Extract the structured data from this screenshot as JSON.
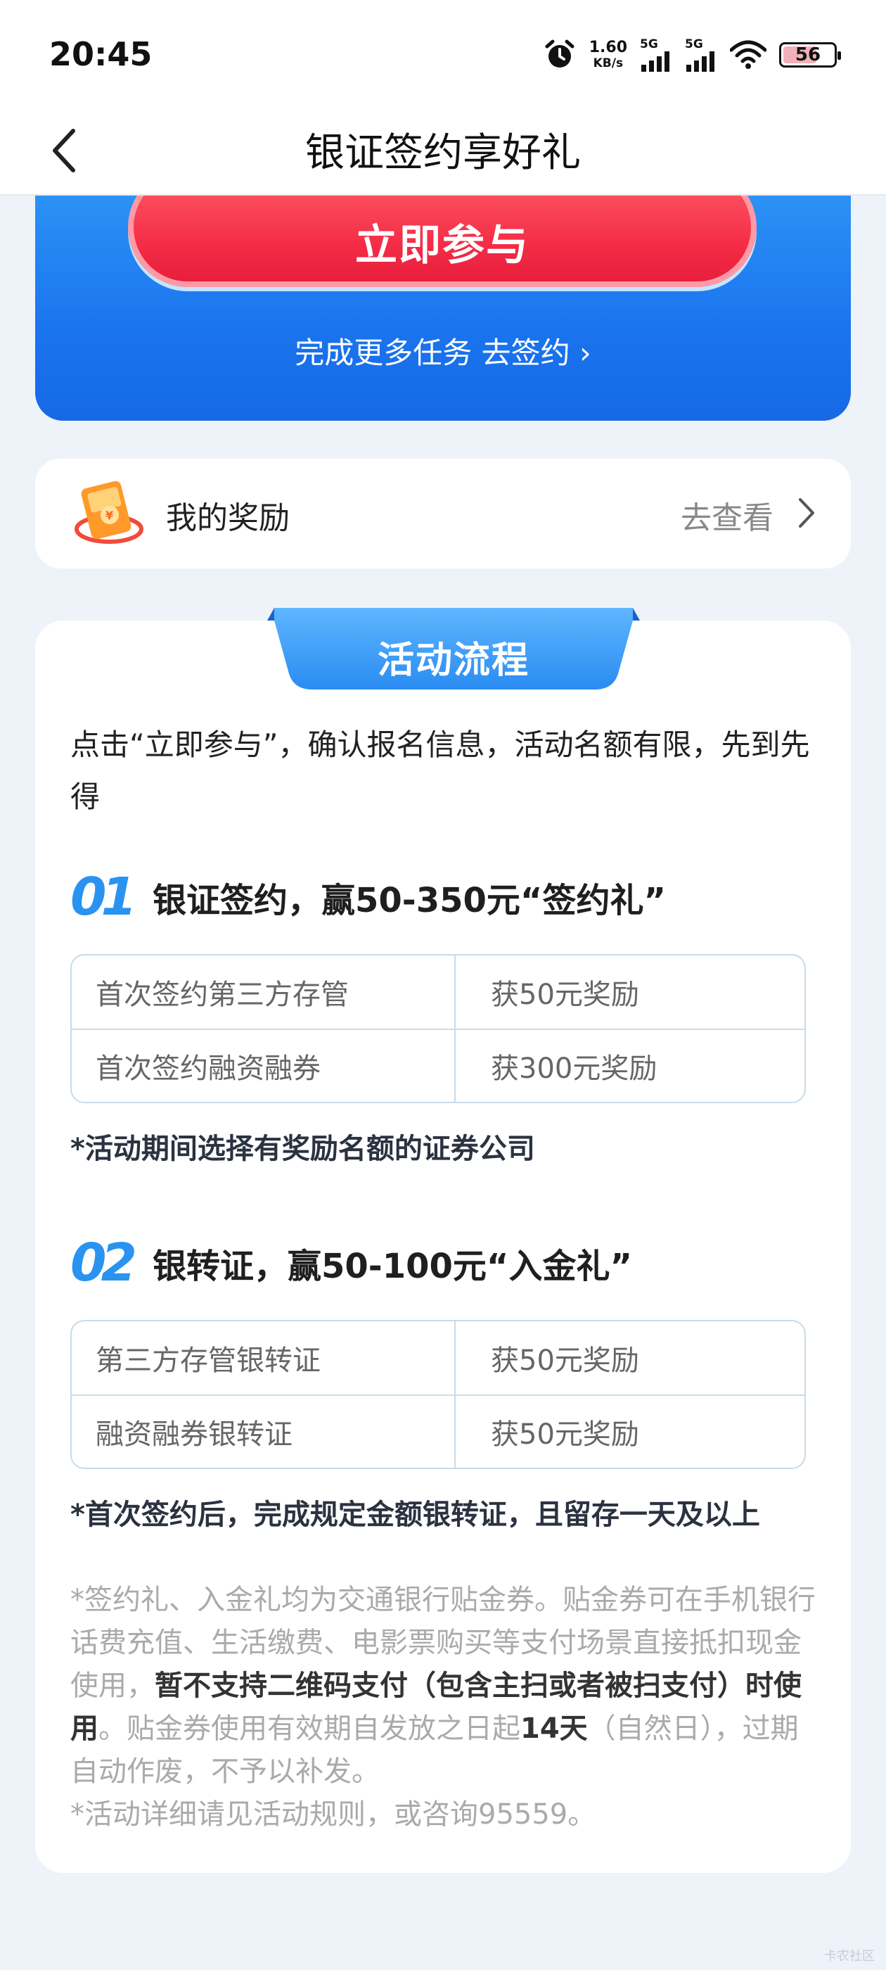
{
  "status_bar": {
    "time": "20:45",
    "net_speed_value": "1.60",
    "net_speed_unit": "KB/s",
    "sim1": "5G",
    "sim2": "5G",
    "battery": "56"
  },
  "nav": {
    "title": "银证签约享好礼"
  },
  "banner": {
    "join_button": "立即参与",
    "more_tasks_link": "完成更多任务 去签约 ›"
  },
  "rewards": {
    "label": "我的奖励",
    "view": "去查看"
  },
  "process": {
    "tab_title": "活动流程",
    "intro": "点击“立即参与”，确认报名信息，活动名额有限，先到先得",
    "step1": {
      "num": "01",
      "title": "银证签约，赢50-350元“签约礼”",
      "rows": [
        {
          "item": "首次签约第三方存管",
          "reward": "获50元奖励"
        },
        {
          "item": "首次签约融资融券",
          "reward": "获300元奖励"
        }
      ],
      "note": "*活动期间选择有奖励名额的证券公司"
    },
    "step2": {
      "num": "02",
      "title": "银转证，赢50-100元“入金礼”",
      "rows": [
        {
          "item": "第三方存管银转证",
          "reward": "获50元奖励"
        },
        {
          "item": "融资融券银转证",
          "reward": "获50元奖励"
        }
      ],
      "note": "*首次签约后，完成规定金额银转证，且留存一天及以上"
    },
    "fineprint": {
      "p1_a": "*签约礼、入金礼均为交通银行贴金券。贴金券可在手机银行话费充值、生活缴费、电影票购买等支付场景直接抵扣现金使用，",
      "p1_bold": "暂不支持二维码支付（包含主扫或者被扫支付）时使用",
      "p1_b": "。贴金券使用有效期自发放之日起",
      "p1_bold2": "14天",
      "p1_c": "（自然日），过期自动作废，不予以补发。",
      "p2": "*活动详细请见活动规则，或咨询95559。"
    }
  },
  "watermark": "卡农社区",
  "colors": {
    "primary_blue": "#1a74ee",
    "join_red": "#f32a45",
    "step_blue": "#2a93f0"
  }
}
